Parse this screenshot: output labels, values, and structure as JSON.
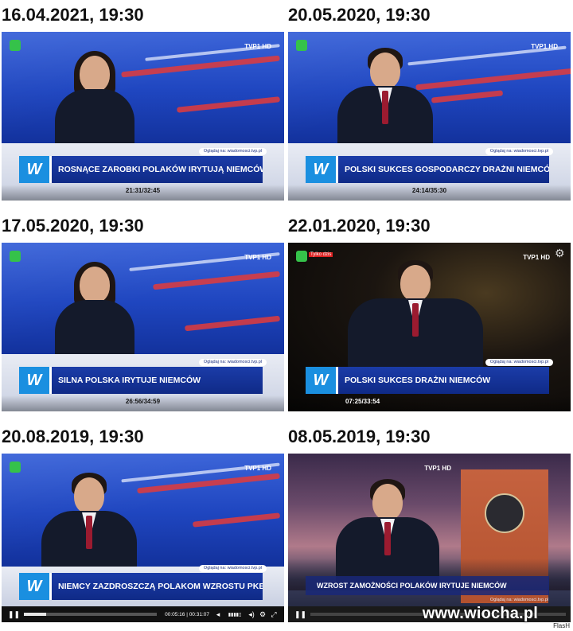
{
  "panels": [
    {
      "date": "16.04.2021, 19:30",
      "headline": "ROSNĄCE ZAROBKI POLAKÓW IRYTUJĄ NIEMCÓW",
      "timecode": "21:31/32:45",
      "url": "Oglądaj na: wiadomosci.tvp.pl",
      "channel": "TVP1 HD"
    },
    {
      "date": "20.05.2020, 19:30",
      "headline": "POLSKI SUKCES GOSPODARCZY DRAŻNI NIEMCÓW",
      "timecode": "24:14/35:30",
      "url": "Oglądaj na: wiadomosci.tvp.pl",
      "channel": "TVP1 HD"
    },
    {
      "date": "17.05.2020, 19:30",
      "headline": "SILNA POLSKA IRYTUJE NIEMCÓW",
      "timecode": "26:56/34:59",
      "url": "Oglądaj na: wiadomosci.tvp.pl",
      "channel": "TVP1 HD"
    },
    {
      "date": "22.01.2020, 19:30",
      "headline": "POLSKI SUKCES DRAŻNI NIEMCÓW",
      "timecode": "07:25/33:54",
      "url": "Oglądaj na: wiadomosci.tvp.pl",
      "channel": "TVP1 HD",
      "live_tag": "Tylko dzis"
    },
    {
      "date": "20.08.2019, 19:30",
      "headline": "NIEMCY ZAZDROSZCZĄ POLAKOM WZROSTU PKB",
      "timecode": "00:05:16 | 00:31:07",
      "url": "Oglądaj na: wiadomosci.tvp.pl",
      "channel": "TVP1 HD",
      "progress": 0.17
    },
    {
      "date": "08.05.2019, 19:30",
      "headline": "WZROST ZAMOŻNOŚCI POLAKÓW IRYTUJE NIEMCÓW",
      "url": "Oglądaj na: wiadomosci.tvp.pl",
      "channel": "TVP1 HD"
    }
  ],
  "watermark": "www.wiocha.pl",
  "watermark_sub": "FlasH",
  "icons": {
    "play": "pause-icon",
    "settings": "gear-icon",
    "volume": "volume-icon",
    "fullscreen": "fullscreen-icon"
  },
  "colors": {
    "ticker_blue": "#0f2a87",
    "logo_blue": "#1a8fe0",
    "studio_red": "#e23b3b",
    "logo_green": "#35c24a"
  }
}
